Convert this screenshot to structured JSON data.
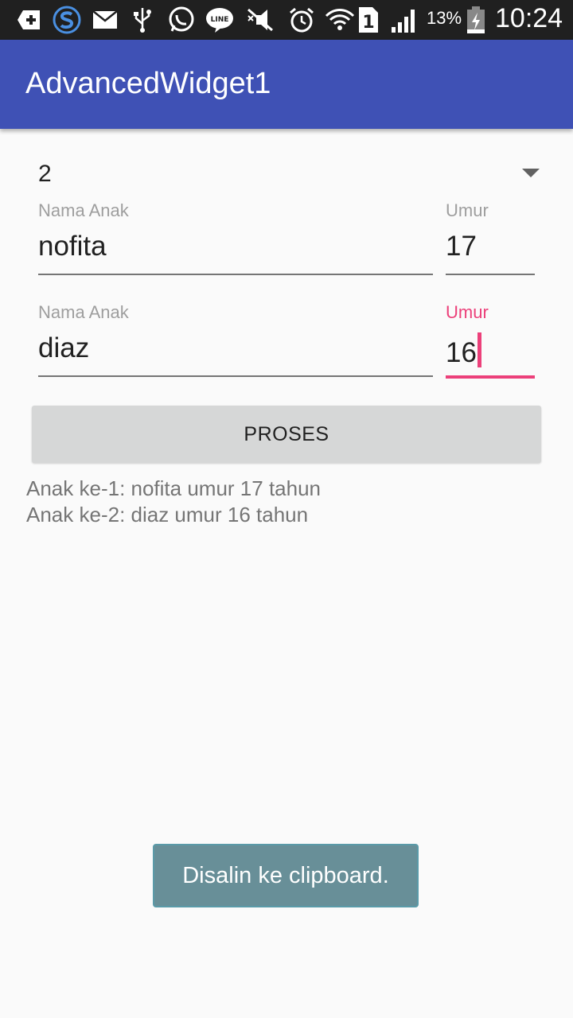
{
  "status_bar": {
    "icons": [
      "add-icon",
      "s-app-icon",
      "mail-icon",
      "usb-icon",
      "whatsapp-icon",
      "line-icon",
      "mute-icon",
      "alarm-icon",
      "wifi-icon",
      "sim-1-icon",
      "signal-icon",
      "battery-icon"
    ],
    "sim_number": "1",
    "battery_percent": "13%",
    "time": "10:24"
  },
  "app_bar": {
    "title": "AdvancedWidget1"
  },
  "spinner": {
    "selected": "2"
  },
  "children": [
    {
      "name_label": "Nama Anak",
      "name_value": "nofita",
      "age_label": "Umur",
      "age_value": "17"
    },
    {
      "name_label": "Nama Anak",
      "name_value": "diaz",
      "age_label": "Umur",
      "age_value": "16"
    }
  ],
  "process_button": {
    "label": "PROSES"
  },
  "results": [
    "Anak ke-1: nofita umur 17 tahun",
    "Anak ke-2: diaz umur 16 tahun"
  ],
  "toast": {
    "message": "Disalin ke clipboard."
  },
  "colors": {
    "app_bar": "#3f51b5",
    "accent": "#ec407a",
    "toast_bg": "#688f98"
  }
}
